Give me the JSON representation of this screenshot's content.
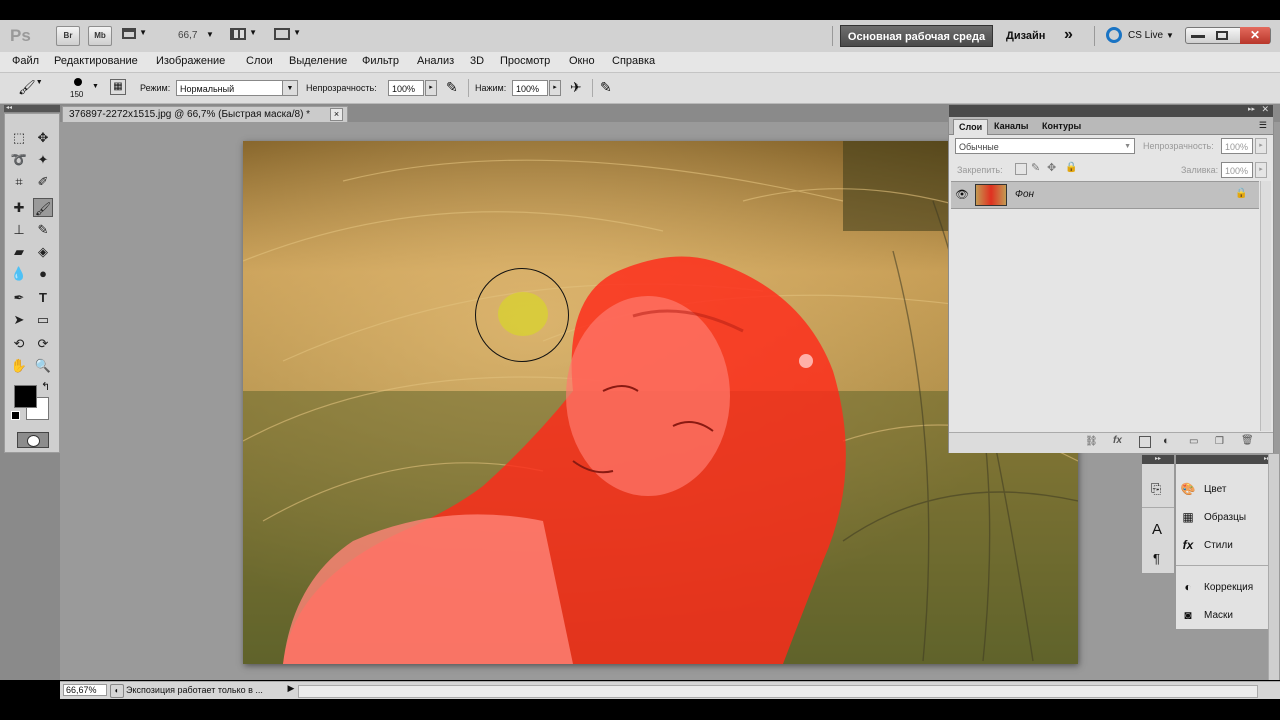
{
  "app": {
    "logo": "Ps",
    "bridge_label": "Br",
    "minibridge_label": "Mb",
    "zoom_value": "66,7",
    "workspace_button": "Основная рабочая среда",
    "design_label": "Дизайн",
    "more_glyph": "»",
    "cslive_label": "CS Live"
  },
  "menu": [
    "Файл",
    "Редактирование",
    "Изображение",
    "Слои",
    "Выделение",
    "Фильтр",
    "Анализ",
    "3D",
    "Просмотр",
    "Окно",
    "Справка"
  ],
  "options": {
    "brush_size": "150",
    "mode_label": "Режим:",
    "mode_value": "Нормальный",
    "opacity_label": "Непрозрачность:",
    "opacity_value": "100%",
    "pressure_label": "Нажим:",
    "pressure_value": "100%"
  },
  "document": {
    "tab_title": "376897-2272x1515.jpg @ 66,7% (Быстрая маска/8) *",
    "close_glyph": "×"
  },
  "status": {
    "zoom": "66,67%",
    "info": "Экспозиция работает только в ..."
  },
  "layers_panel": {
    "tabs": [
      "Слои",
      "Каналы",
      "Контуры"
    ],
    "blend_mode": "Обычные",
    "opacity_label": "Непрозрачность:",
    "opacity_value": "100%",
    "lock_label": "Закрепить:",
    "fill_label": "Заливка:",
    "fill_value": "100%",
    "layer_name": "Фон"
  },
  "dock": {
    "items": [
      {
        "icon": "color-icon",
        "label": "Цвет"
      },
      {
        "icon": "swatches-icon",
        "label": "Образцы"
      },
      {
        "icon": "styles-icon",
        "label": "Стили"
      },
      {
        "icon": "adjustments-icon",
        "label": "Коррекция"
      },
      {
        "icon": "masks-icon",
        "label": "Маски"
      }
    ]
  },
  "colors": {
    "foreground": "#000000",
    "background": "#ffffff",
    "quickmask_overlay": "#ff0000"
  }
}
